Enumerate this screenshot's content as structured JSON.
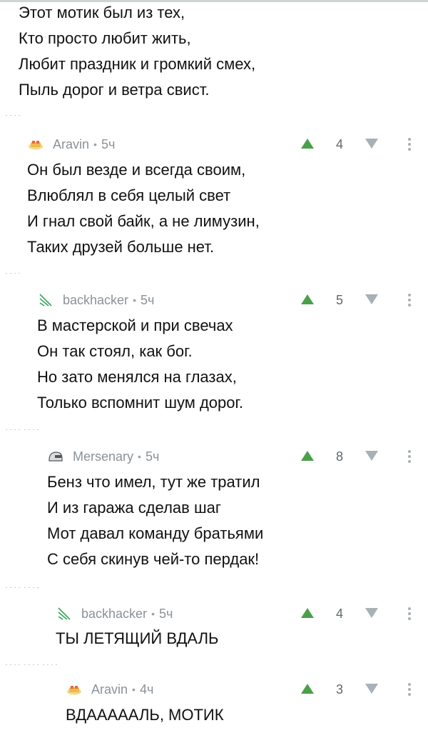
{
  "top_poem": {
    "lines": [
      "Этот мотик был из тех,",
      "Кто просто любит жить,",
      "Любит праздник и громкий смех,",
      "Пыль дорог и ветра свист."
    ]
  },
  "comments": [
    {
      "author": "Aravin",
      "dot": "•",
      "time": "5ч",
      "rating": "4",
      "avatar_icon": "cake-avatar-icon",
      "lines": [
        "Он был везде и всегда своим,",
        "Влюблял в себя целый свет",
        "И гнал свой байк, а не лимузин,",
        "Таких друзей больше нет."
      ]
    },
    {
      "author": "backhacker",
      "dot": "•",
      "time": "5ч",
      "rating": "5",
      "avatar_icon": "slash-lines-avatar-icon",
      "lines": [
        "В мастерской и при свечах",
        "Он так стоял, как бог.",
        "Но зато менялся на глазах,",
        "Только вспомнит шум дорог."
      ]
    },
    {
      "author": "Mersenary",
      "dot": "•",
      "time": "5ч",
      "rating": "8",
      "avatar_icon": "helmet-avatar-icon",
      "lines": [
        "Бенз что имел, тут же тратил",
        "И из гаража сделав шаг",
        "Мот давал команду братьями",
        "С себя скинув чей-то пердак!"
      ]
    },
    {
      "author": "backhacker",
      "dot": "•",
      "time": "5ч",
      "rating": "4",
      "avatar_icon": "slash-lines-avatar-icon",
      "lines": [
        "ТЫ ЛЕТЯЩИЙ ВДАЛЬ"
      ]
    },
    {
      "author": "Aravin",
      "dot": "•",
      "time": "4ч",
      "rating": "3",
      "avatar_icon": "cake-avatar-icon",
      "lines": [
        "ВДАААААЛЬ, МОТИК"
      ]
    }
  ],
  "colors": {
    "upvote": "#4aa04a",
    "downvote": "#a7b1b6",
    "meta_text": "#8a9297",
    "body_text": "#111111"
  }
}
